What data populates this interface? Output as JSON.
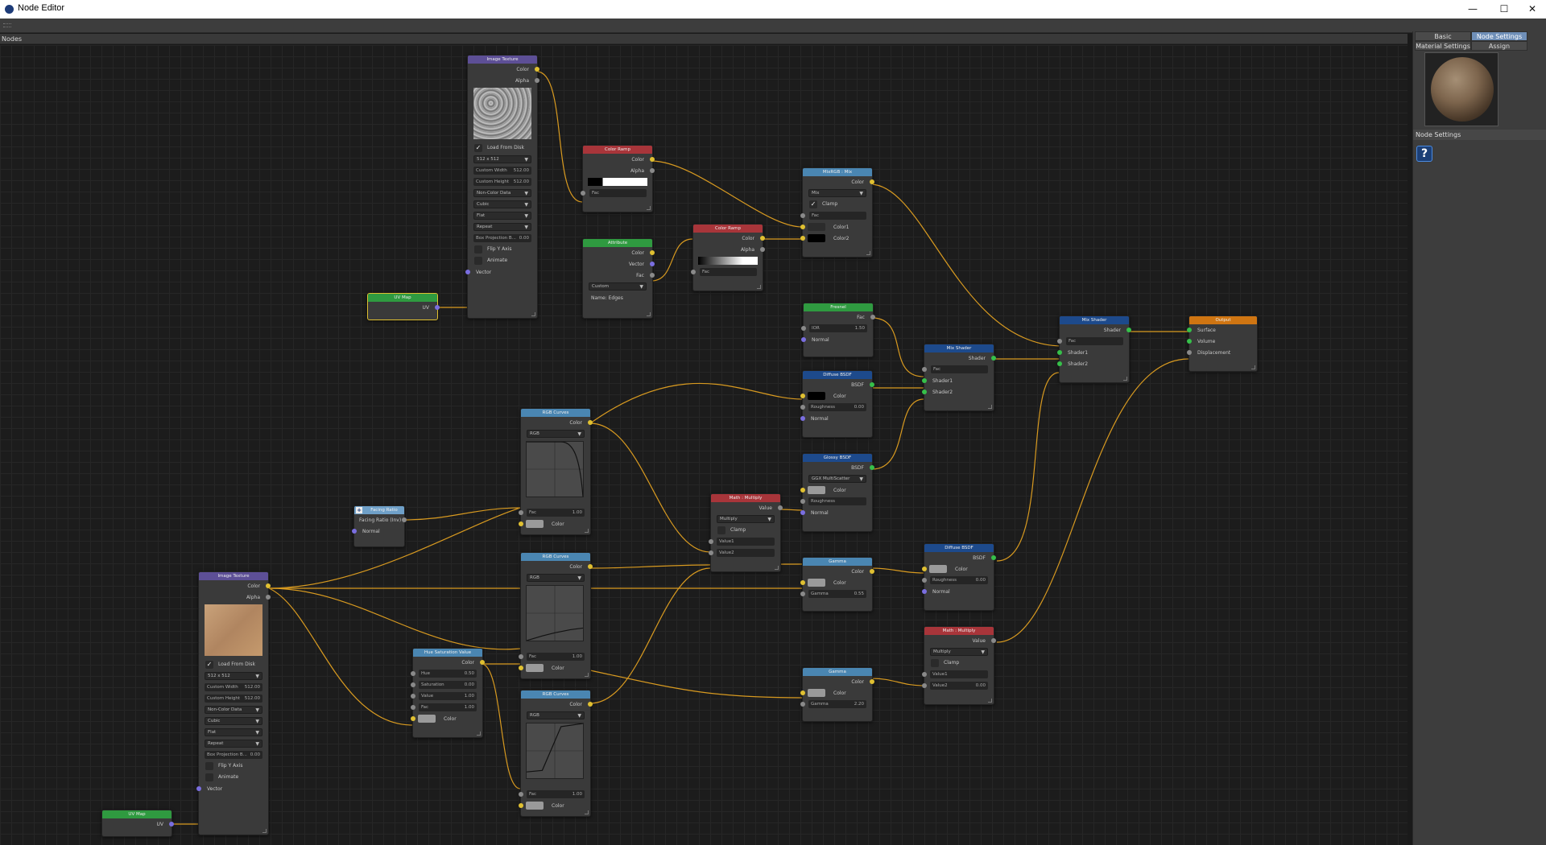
{
  "window": {
    "title": "Node Editor",
    "minimize": "—",
    "maximize": "☐",
    "close": "✕"
  },
  "canvas": {
    "label": "Nodes"
  },
  "panel": {
    "tabs": [
      "Basic",
      "Node Settings",
      "Material Settings",
      "Assign"
    ],
    "node_settings_label": "Node Settings",
    "help_icon": "?"
  },
  "labels": {
    "color": "Color",
    "alpha": "Alpha",
    "vector": "Vector",
    "uv": "UV",
    "fac": "Fac",
    "normal": "Normal",
    "shader": "Shader",
    "shader1": "Shader1",
    "shader2": "Shader2",
    "bsdf": "BSDF",
    "value": "Value",
    "value1": "Value1",
    "value2": "Value2",
    "roughness": "Roughness",
    "ior": "IOR",
    "gamma": "Gamma",
    "rgb": "RGB",
    "clamp": "Clamp",
    "color1": "Color1",
    "color2": "Color2",
    "mix": "Mix",
    "multiply": "Multiply",
    "custom": "Custom",
    "hue": "Hue",
    "saturation": "Saturation",
    "surface": "Surface",
    "volume": "Volume",
    "displacement": "Displacement",
    "load_from_disk": "Load From Disk",
    "size": "512 x 512",
    "custom_width": "Custom Width",
    "custom_height": "Custom Height",
    "non_color": "Non-Color Data",
    "cubic": "Cubic",
    "flat": "Flat",
    "repeat": "Repeat",
    "box_projection": "Box Projection B...",
    "flip_y": "Flip Y Axis",
    "animate": "Animate",
    "facing_ratio": "Facing Ratio (Inv)",
    "ggx": "GGX MultiScatter",
    "name_edges": "Name: Edges",
    "check": "✓"
  },
  "values": {
    "v512": "512.00",
    "v000": "0.00",
    "v050": "0.50",
    "v100": "1.00",
    "v150": "1.50",
    "v055": "0.55",
    "v220": "2.20"
  },
  "titles": {
    "image_texture": "Image Texture",
    "color_ramp": "Color Ramp",
    "attribute": "Attribute",
    "mix_rgb": "MixRGB : Mix",
    "uv_map": "UV Map",
    "fresnel": "Fresnel",
    "mix_shader": "Mix Shader",
    "output": "Output",
    "diffuse": "Diffuse BSDF",
    "glossy": "Glossy BSDF",
    "rgb_curves": "RGB Curves",
    "facing_ratio": "Facing Ratio",
    "math_multiply": "Math : Multiply",
    "gamma": "Gamma",
    "hsv": "Hue Saturation Value"
  }
}
